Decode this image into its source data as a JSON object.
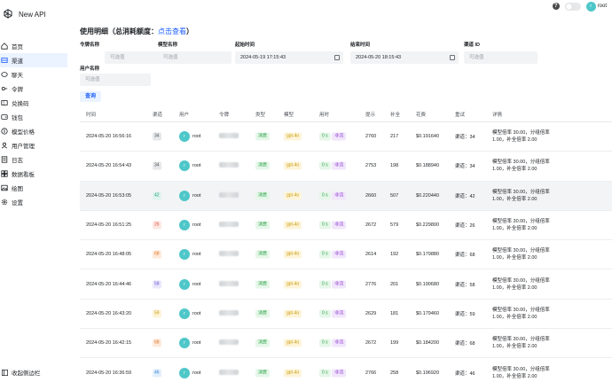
{
  "app": {
    "name": "New API"
  },
  "header": {
    "help_label": "?",
    "user_name": "root",
    "user_initial": "r"
  },
  "sidebar": {
    "items": [
      {
        "label": "首页",
        "icon": "home-icon",
        "active": false
      },
      {
        "label": "渠道",
        "icon": "channel-icon",
        "active": true
      },
      {
        "label": "聊天",
        "icon": "chat-icon",
        "active": false
      },
      {
        "label": "令牌",
        "icon": "key-icon",
        "active": false
      },
      {
        "label": "兑换码",
        "icon": "coupon-icon",
        "active": false
      },
      {
        "label": "钱包",
        "icon": "wallet-icon",
        "active": false
      },
      {
        "label": "模型价格",
        "icon": "price-icon",
        "active": false
      },
      {
        "label": "用户管理",
        "icon": "users-icon",
        "active": false
      },
      {
        "label": "日志",
        "icon": "log-icon",
        "active": false
      },
      {
        "label": "数据看板",
        "icon": "dashboard-icon",
        "active": false
      },
      {
        "label": "绘图",
        "icon": "image-icon",
        "active": false
      },
      {
        "label": "设置",
        "icon": "settings-icon",
        "active": false
      }
    ],
    "collapse_label": "收起侧边栏"
  },
  "page": {
    "title": "使用明细（总消耗额度：",
    "title_link": "点击查看",
    "title_close": "）"
  },
  "filters": {
    "token_name": {
      "label": "令牌名称",
      "placeholder": "可选值"
    },
    "model_name": {
      "label": "模型名称",
      "placeholder": "可选值"
    },
    "start_time": {
      "label": "起始时间",
      "value": "2024-05-19 17:15:43"
    },
    "end_time": {
      "label": "结束时间",
      "value": "2024-05-20 18:15:43"
    },
    "channel_id": {
      "label": "渠道 ID",
      "placeholder": "可选值"
    },
    "username": {
      "label": "用户名称",
      "placeholder": "可选值"
    },
    "query_label": "查询"
  },
  "table": {
    "columns": [
      "时间",
      "渠道",
      "用户",
      "令牌",
      "类型",
      "模型",
      "用时",
      "提示",
      "补全",
      "花费",
      "重试",
      "详情"
    ],
    "rows": [
      {
        "time": "2024-05-20 16:56:16",
        "channel": "34",
        "ch_color": "#e6e8ea",
        "ch_text": "#4b4f55",
        "user": "root",
        "type": "消费",
        "model": "gpt-4o",
        "duration": "0 s",
        "stream": "非流",
        "prompt": "2760",
        "completion": "217",
        "cost": "$0.191640",
        "retry": "渠道：34",
        "detail": "模型倍率 30.00，分组倍率 1.00，补全倍率 2.00"
      },
      {
        "time": "2024-05-20 16:54:43",
        "channel": "34",
        "ch_color": "#e6e8ea",
        "ch_text": "#4b4f55",
        "user": "root",
        "type": "消费",
        "model": "gpt-4o",
        "duration": "0 s",
        "stream": "非流",
        "prompt": "2753",
        "completion": "198",
        "cost": "$0.188940",
        "retry": "渠道：34",
        "detail": "模型倍率 30.00，分组倍率 1.00，补全倍率 2.00"
      },
      {
        "time": "2024-05-20 16:53:05",
        "channel": "42",
        "ch_color": "#dff4ee",
        "ch_text": "#1f9d7a",
        "user": "root",
        "type": "消费",
        "model": "gpt-4o",
        "duration": "0 s",
        "stream": "非流",
        "prompt": "2660",
        "completion": "507",
        "cost": "$0.220440",
        "retry": "渠道：42",
        "detail": "模型倍率 30.00，分组倍率 1.00，补全倍率 2.00"
      },
      {
        "time": "2024-05-20 16:51:25",
        "channel": "26",
        "ch_color": "#fde7e4",
        "ch_text": "#e0533f",
        "user": "root",
        "type": "消费",
        "model": "gpt-4o",
        "duration": "0 s",
        "stream": "非流",
        "prompt": "2672",
        "completion": "579",
        "cost": "$0.229800",
        "retry": "渠道：26",
        "detail": "模型倍率 30.00，分组倍率 1.00，补全倍率 2.00"
      },
      {
        "time": "2024-05-20 16:48:05",
        "channel": "68",
        "ch_color": "#fdeadb",
        "ch_text": "#e37420",
        "user": "root",
        "type": "消费",
        "model": "gpt-4o",
        "duration": "0 s",
        "stream": "非流",
        "prompt": "2614",
        "completion": "192",
        "cost": "$0.179880",
        "retry": "渠道：68",
        "detail": "模型倍率 30.00，分组倍率 1.00，补全倍率 2.00"
      },
      {
        "time": "2024-05-20 16:44:46",
        "channel": "58",
        "ch_color": "#ebe7fb",
        "ch_text": "#6b55d6",
        "user": "root",
        "type": "消费",
        "model": "gpt-4o",
        "duration": "0 s",
        "stream": "非流",
        "prompt": "2776",
        "completion": "201",
        "cost": "$0.190680",
        "retry": "渠道：58",
        "detail": "模型倍率 30.00，分组倍率 1.00，补全倍率 2.00"
      },
      {
        "time": "2024-05-20 16:43:20",
        "channel": "59",
        "ch_color": "#fdf4d9",
        "ch_text": "#c99a06",
        "user": "root",
        "type": "消费",
        "model": "gpt-4o",
        "duration": "0 s",
        "stream": "非流",
        "prompt": "2629",
        "completion": "181",
        "cost": "$0.179460",
        "retry": "渠道：59",
        "detail": "模型倍率 30.00，分组倍率 1.00，补全倍率 2.00"
      },
      {
        "time": "2024-05-20 16:42:15",
        "channel": "68",
        "ch_color": "#fdeadb",
        "ch_text": "#e37420",
        "user": "root",
        "type": "消费",
        "model": "gpt-4o",
        "duration": "0 s",
        "stream": "非流",
        "prompt": "2672",
        "completion": "199",
        "cost": "$0.184200",
        "retry": "渠道：68",
        "detail": "模型倍率 30.00，分组倍率 1.00，补全倍率 2.00"
      },
      {
        "time": "2024-05-20 16:36:59",
        "channel": "46",
        "ch_color": "#e3f0fd",
        "ch_text": "#2f7fd6",
        "user": "root",
        "type": "消费",
        "model": "gpt-4o",
        "duration": "0 s",
        "stream": "非流",
        "prompt": "2766",
        "completion": "258",
        "cost": "$0.196920",
        "retry": "渠道：46",
        "detail": "模型倍率 30.00，分组倍率 1.00，补全倍率 2.00"
      }
    ]
  }
}
